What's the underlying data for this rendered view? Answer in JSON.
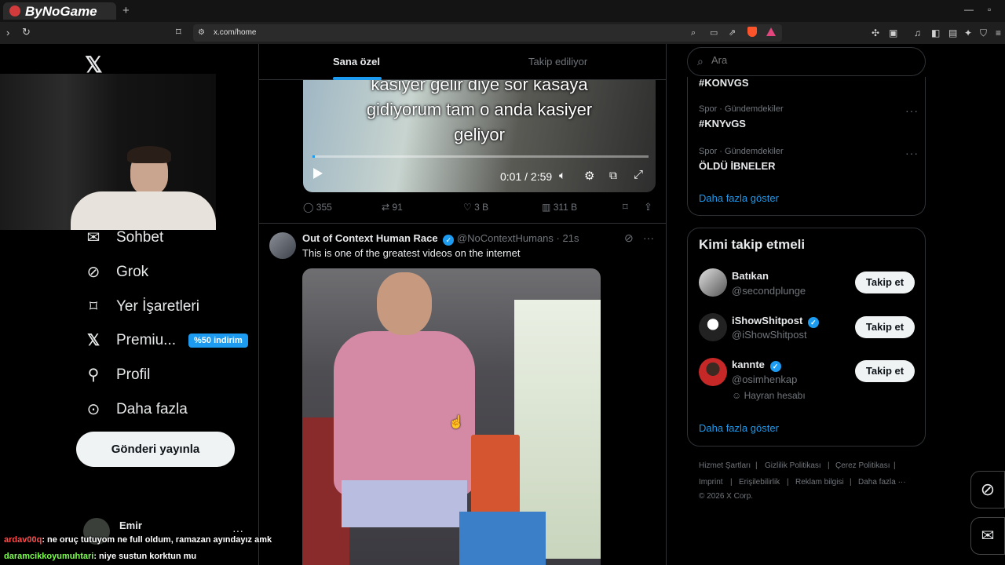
{
  "browser": {
    "tab_title": "ByNoGame",
    "new_tab": "+",
    "url": "x.com/home"
  },
  "feed_tabs": [
    "Sana özel",
    "Takip ediliyor"
  ],
  "search": {
    "placeholder": "Ara"
  },
  "nav": {
    "items": [
      {
        "label": "Sohbet",
        "icon": "mail-icon"
      },
      {
        "label": "Grok",
        "icon": "grok-icon"
      },
      {
        "label": "Yer İşaretleri",
        "icon": "bookmark-icon"
      },
      {
        "label": "Premiu...",
        "icon": "x-logo-icon",
        "badge": "%50 indirim"
      },
      {
        "label": "Profil",
        "icon": "person-icon"
      },
      {
        "label": "Daha fazla",
        "icon": "more-circle-icon"
      }
    ],
    "post_button": "Gönderi yayınla",
    "account_name": "Emir",
    "account_menu": "···"
  },
  "video1": {
    "caption_lines": [
      "kasiyer gelir diye sor kasaya",
      "gidiyorum tam o anda kasiyer",
      "geliyor"
    ],
    "time": "0:01 / 2:59",
    "progress": 0.006
  },
  "post1_actions": {
    "replies": "355",
    "reposts": "91",
    "likes": "3 B",
    "views": "311 B"
  },
  "post2": {
    "author": "Out of Context Human Race",
    "handle": "@NoContextHumans",
    "time": "21s",
    "text": "This is one of the greatest videos on the internet",
    "more": "···"
  },
  "trends": [
    {
      "category": "",
      "name": "#KONVGS"
    },
    {
      "category": "Spor · Gündemdekiler",
      "name": "#KNYvGS"
    },
    {
      "category": "Spor · Gündemdekiler",
      "name": "ÖLDÜ İBNELER"
    }
  ],
  "trend_more": "···",
  "show_more": "Daha fazla göster",
  "who_to_follow": {
    "title": "Kimi takip etmeli",
    "users": [
      {
        "name": "Batıkan",
        "handle": "@secondplunge",
        "verified": false,
        "note": ""
      },
      {
        "name": "iShowShitpost",
        "handle": "@iShowShitpost",
        "verified": true,
        "note": ""
      },
      {
        "name": "kannte",
        "handle": "@osimhenkap",
        "verified": true,
        "note": "Hayran hesabı"
      }
    ],
    "follow_label": "Takip et",
    "show_more": "Daha fazla göster"
  },
  "footer": {
    "links": [
      "Hizmet Şartları",
      "Gizlilik Politikası",
      "Çerez Politikası",
      "Imprint",
      "Erişilebilirlik",
      "Reklam bilgisi",
      "Daha fazla ···"
    ],
    "copyright": "© 2026 X Corp."
  },
  "stream_chat": [
    {
      "user": "ardav00q",
      "text": ": ne oruç tutuyom ne full oldum, ramazan ayındayız amk",
      "color": "#ff4d4d"
    },
    {
      "user": "daramcikkoyumuhtari",
      "text": ": niye sustun korktun mu",
      "color": "#7cff4d"
    }
  ],
  "colors": {
    "accent": "#1d9bf0",
    "background": "#000000",
    "border": "#2f3336"
  }
}
